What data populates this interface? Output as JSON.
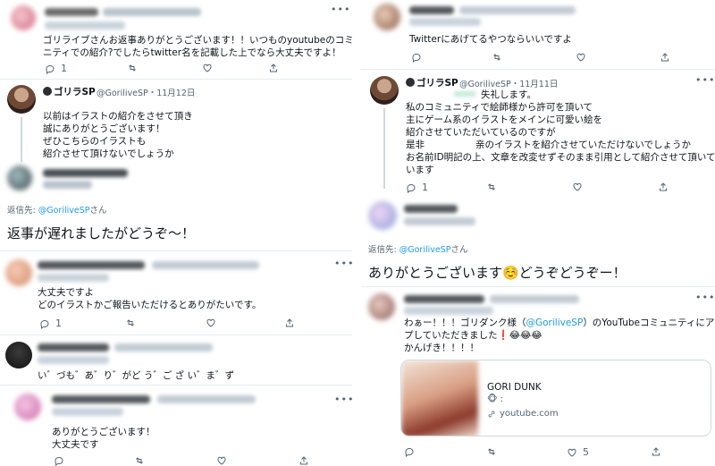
{
  "left": {
    "t1": {
      "text_l1": "ゴリライブさんお返事ありがとうございます！！いつものyoutubeのコミュ",
      "text_l2": "ニティでの紹介?でしたらtwitter名を記載した上でなら大丈夫ですよ！",
      "reply_count": "1"
    },
    "t2": {
      "name": "ゴリラSP",
      "handle": "@GoriliveSP・11月12日",
      "l1": "以前はイラストの紹介をさせて頂き",
      "l2": "誠にありがとうございます！",
      "l3": "ぜひこちらのイラストも",
      "l4": "紹介させて頂けないでしょうか"
    },
    "t3": {
      "reply_to_prefix": "返信先: ",
      "reply_to_handle": "@GoriliveSP",
      "reply_to_suffix": "さん",
      "big_text": "返事が遅れましたがどうぞ～！"
    },
    "t4": {
      "l1": "大丈夫ですよ",
      "l2": "どのイラストかご報告いただけるとありがたいです。",
      "reply_count": "1"
    },
    "t5": {
      "text": "い゛づも゛あ゛り゛がど う゛ご ざ い゛ま゛ず"
    },
    "t6": {
      "l1": "ありがとうございます！",
      "l2": "大丈夫です"
    }
  },
  "right": {
    "t1": {
      "text": "Twitterにあげてるやつならいいですよ"
    },
    "t2": {
      "name": "ゴリラSP",
      "handle": "@GoriliveSP・11月11日",
      "l1": "失礼します。",
      "l2": "私のコミュニティで絵師様から許可を頂いて",
      "l3": "主にゲーム系のイラストをメインに可愛い絵を",
      "l4": "紹介させていただいているのですが",
      "l5a": "是非",
      "l5b": "亲のイラストを紹介させていただけないでしょうか",
      "l6": "お名前ID明記の上、文章を改変せずそのまま引用として紹介させて頂いて",
      "l7": "います",
      "reply_count": "1"
    },
    "t3": {
      "reply_to_prefix": "返信先: ",
      "reply_to_handle": "@GoriliveSP",
      "reply_to_suffix": "さん",
      "big_text": "ありがとうございます☺️どうぞどうぞー！"
    },
    "t4": {
      "l1a": "わぁー！！！ゴリダンク様（",
      "l1b": "@GoriliveSP",
      "l1c": "）のYouTubeコミュニティにアッ",
      "l2": "プしていただきました❗😂😂😂",
      "l3": "かんげき！！！！",
      "card_title": "GORI DUNK",
      "card_sub": "🐵 :",
      "card_domain": "youtube.com",
      "like_count": "5"
    }
  },
  "colors": {
    "accent": "#1d9bf0",
    "muted": "#536471",
    "border": "#e6ecf0"
  },
  "icons": [
    "reply-icon",
    "retweet-icon",
    "like-icon",
    "share-icon",
    "more-icon",
    "link-icon"
  ]
}
